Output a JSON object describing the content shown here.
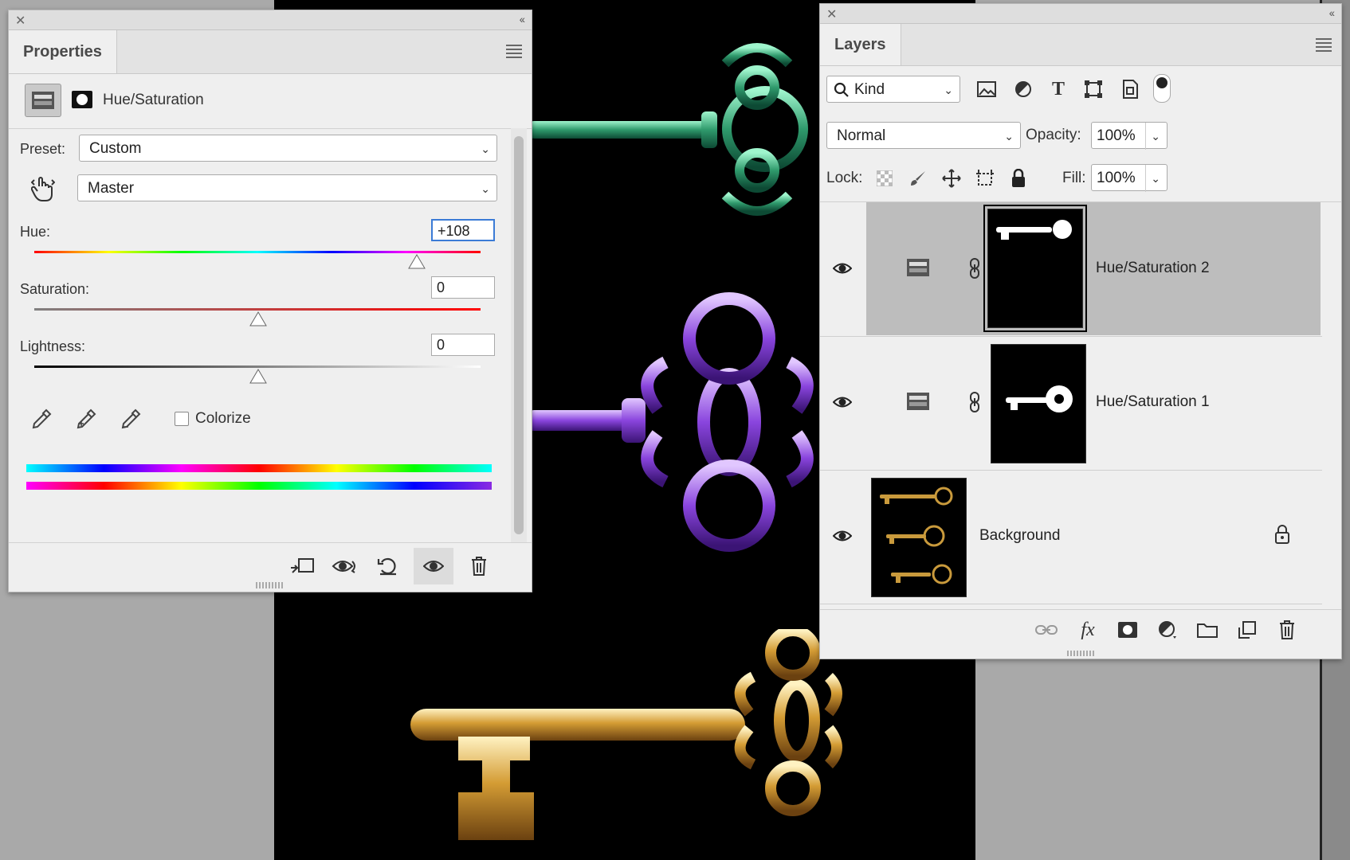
{
  "colors": {
    "panel_bg": "#efefef",
    "selected_row": "#bdbdbd",
    "accent": "#3b7bd6",
    "green_key": "#3fae82",
    "purple_key": "#9b59e6",
    "gold_key": "#d7a441"
  },
  "properties": {
    "tab": "Properties",
    "adjustment_title": "Hue/Saturation",
    "preset_label": "Preset:",
    "preset_value": "Custom",
    "channel_value": "Master",
    "hue_label": "Hue:",
    "hue_value": "+108",
    "saturation_label": "Saturation:",
    "saturation_value": "0",
    "lightness_label": "Lightness:",
    "lightness_value": "0",
    "colorize_label": "Colorize",
    "colorize_checked": false,
    "icons": [
      "adjustment-icon",
      "mask-icon",
      "targeted-adjust-icon",
      "eyedropper-icon",
      "eyedropper-plus-icon",
      "eyedropper-minus-icon",
      "clip-to-layer-icon",
      "view-previous-icon",
      "reset-icon",
      "visibility-icon",
      "delete-icon"
    ]
  },
  "layers": {
    "tab": "Layers",
    "filter_value": "Kind",
    "blend_mode": "Normal",
    "opacity_label": "Opacity:",
    "opacity_value": "100%",
    "lock_label": "Lock:",
    "fill_label": "Fill:",
    "fill_value": "100%",
    "items": [
      {
        "name": "Hue/Saturation 2",
        "selected": true,
        "visible": true
      },
      {
        "name": "Hue/Saturation 1",
        "selected": false,
        "visible": true
      },
      {
        "name": "Background",
        "selected": false,
        "visible": true,
        "locked": true
      }
    ],
    "footer_icons": [
      "link-icon",
      "fx-icon",
      "add-mask-icon",
      "adjustment-layer-icon",
      "group-folder-icon",
      "new-layer-icon",
      "delete-icon"
    ]
  }
}
